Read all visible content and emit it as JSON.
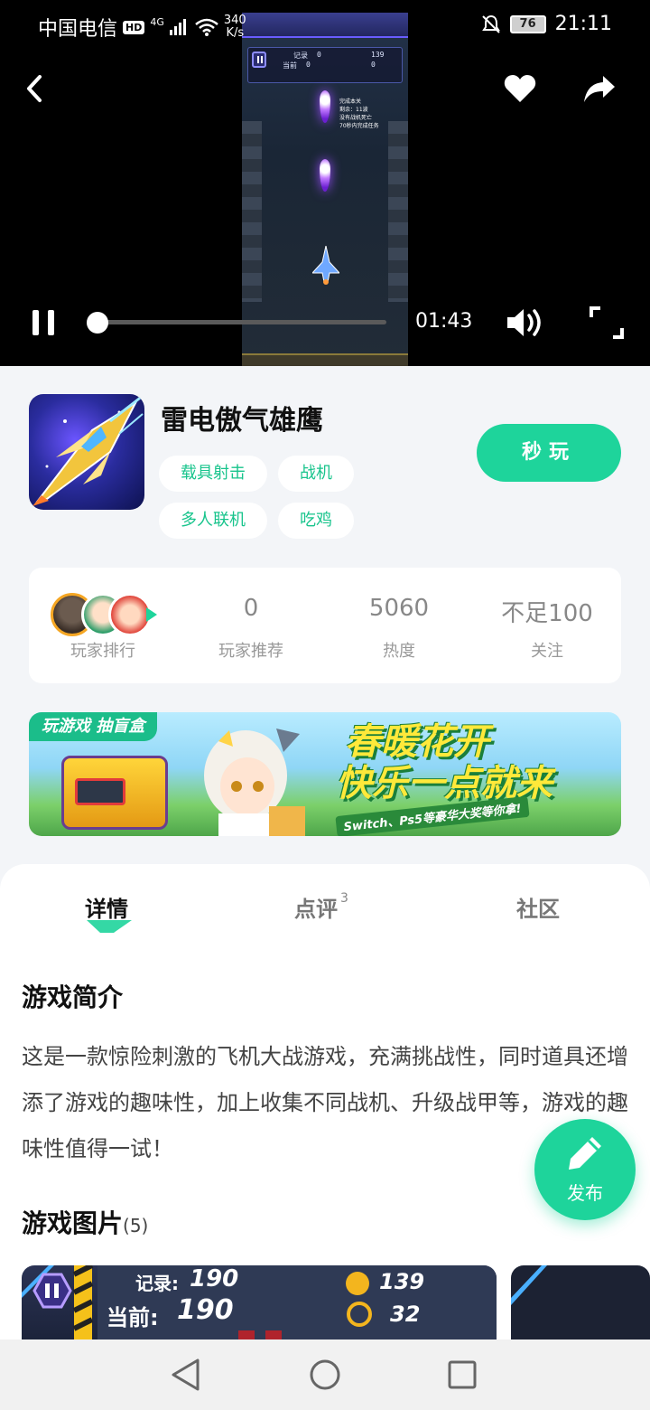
{
  "status_bar": {
    "carrier": "中国电信",
    "hd": "HD",
    "network": "4G",
    "speed_value": "340",
    "speed_unit": "K/s",
    "battery": "76",
    "time": "21:11"
  },
  "video": {
    "elapsed": "01:43",
    "progress_fraction": 0.0,
    "game_hud": {
      "record_label": "记录",
      "record_value": "0",
      "current_label": "当前",
      "current_value": "0",
      "coins": "139",
      "timer": "0"
    },
    "mission_list": [
      "完成本关",
      "剩余：11波",
      "没有战机死亡",
      "70秒内完成任务"
    ]
  },
  "game": {
    "title": "雷电傲气雄鹰",
    "tags": [
      "载具射击",
      "战机",
      "多人联机",
      "吃鸡"
    ],
    "play_button": "秒玩"
  },
  "stats": [
    {
      "label": "玩家排行",
      "value": ""
    },
    {
      "label": "玩家推荐",
      "value": "0"
    },
    {
      "label": "热度",
      "value": "5060"
    },
    {
      "label": "关注",
      "value": "不足100"
    }
  ],
  "banner": {
    "tag": "玩游戏 抽盲盒",
    "headline_1": "春暖花开",
    "headline_2": "快乐一点就来",
    "subline": "Switch、Ps5等豪华大奖等你拿!"
  },
  "tabs": [
    {
      "label": "详情",
      "count": ""
    },
    {
      "label": "点评",
      "count": "3"
    },
    {
      "label": "社区",
      "count": ""
    }
  ],
  "intro": {
    "title": "游戏简介",
    "body": "这是一款惊险刺激的飞机大战游戏，充满挑战性，同时道具还增添了游戏的趣味性，加上收集不同战机、升级战甲等，游戏的趣味性值得一试！"
  },
  "screenshots": {
    "title": "游戏图片",
    "count": "(5)",
    "hud_record_label": "记录:",
    "hud_record": "190",
    "hud_current_label": "当前:",
    "hud_current": "190",
    "hud_coins": "139",
    "hud_timer": "32"
  },
  "fab": {
    "label": "发布"
  },
  "colors": {
    "accent": "#1ed49b",
    "tag_text": "#18c48c"
  }
}
